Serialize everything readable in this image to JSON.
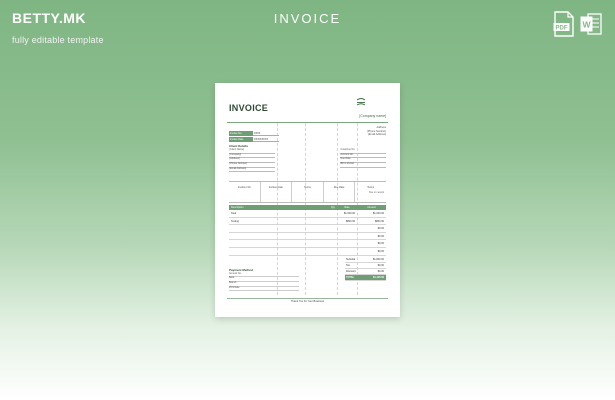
{
  "brand": {
    "logo": "BETTY.MK",
    "tagline": "fully editable template"
  },
  "page": {
    "title": "INVOICE"
  },
  "file_icons": [
    {
      "name": "pdf-icon",
      "label": "PDF",
      "color": "#ffffff"
    },
    {
      "name": "word-icon",
      "label": "W",
      "color": "#ffffff"
    }
  ],
  "colors": {
    "background_top": "#7fb583",
    "background_bottom": "#ffffff",
    "accent_green": "#6f9d74"
  },
  "thumbnail": {
    "title": "INVOICE",
    "company": "[Company name]",
    "address_lines": [
      "Address",
      "[Phone Number]",
      "[Email Address]"
    ],
    "meta": [
      {
        "label": "Invoice No.",
        "value": "XXXX"
      },
      {
        "label": "Invoice Date",
        "value": "XX/XX/XXXX"
      }
    ],
    "client_title": "Client Details",
    "client_left": [
      "[Client Name]",
      "[Company]",
      "[Address]",
      "[Phone Number]",
      "[Email Address]"
    ],
    "client_right": [
      "Customer No.",
      "Account No.",
      "Due Date",
      "Bill to Period"
    ],
    "summary": [
      "Invoice Info",
      "Invoice Date",
      "Terms",
      "Due Date",
      "Terms"
    ],
    "due_words": "Due on receipt",
    "items_header": {
      "desc": "Description",
      "qty": "Qty",
      "rate": "Rate",
      "amount": "Amount"
    },
    "items": [
      {
        "desc": "Task",
        "qty": "",
        "rate": "$1,000.00",
        "amount": "$1,000.00"
      },
      {
        "desc": "Testing",
        "qty": "",
        "rate": "$800.00",
        "amount": "$800.00"
      },
      {
        "desc": "",
        "qty": "",
        "rate": "",
        "amount": "$0.00"
      },
      {
        "desc": "",
        "qty": "",
        "rate": "",
        "amount": "$0.00"
      },
      {
        "desc": "",
        "qty": "",
        "rate": "",
        "amount": "$0.00"
      },
      {
        "desc": "",
        "qty": "",
        "rate": "",
        "amount": "$0.00"
      }
    ],
    "totals": [
      {
        "label": "Subtotal",
        "value": "$1,800.00"
      },
      {
        "label": "Tax",
        "value": "$0.00"
      },
      {
        "label": "Discount",
        "value": "$0.00"
      },
      {
        "label": "TOTAL",
        "value": "$1,115.00"
      }
    ],
    "payment_title": "Payment Method",
    "payment_lines": [
      "Account No.",
      "Bank",
      "Branch",
      "POS Date"
    ],
    "thanks": "Thank You for Your Business"
  }
}
